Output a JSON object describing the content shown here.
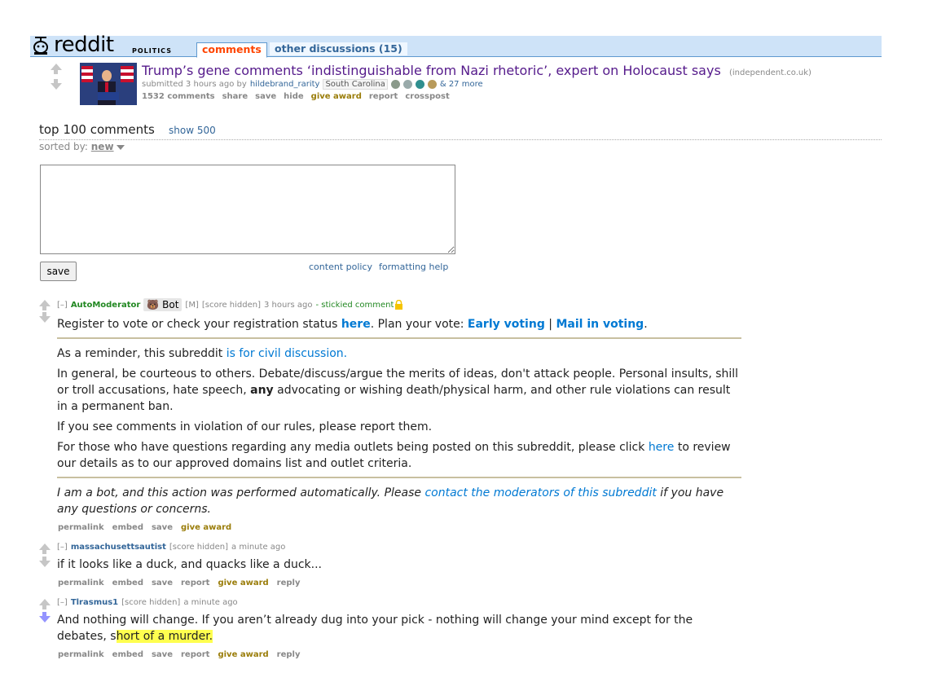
{
  "header": {
    "logo_text": "reddit",
    "subreddit": "politics",
    "tabs": [
      {
        "label": "comments"
      },
      {
        "label": "other discussions (15)"
      }
    ]
  },
  "post": {
    "title": "Trump’s gene comments ‘indistinguishable from Nazi rhetoric’, expert on Holocaust says",
    "domain": "(independent.co.uk)",
    "submitted": "submitted 3 hours ago by",
    "author": "hildebrand_rarity",
    "author_flair": "South Carolina",
    "awards_more": "& 27 more",
    "buttons": {
      "comments": "1532 comments",
      "share": "share",
      "save": "save",
      "hide": "hide",
      "award": "give award",
      "report": "report",
      "crosspost": "crosspost"
    }
  },
  "comments_area": {
    "heading": "top 100 comments",
    "show_more": "show 500",
    "sorted_label": "sorted by:",
    "sort_value": "new",
    "save_label": "save",
    "content_policy": "content policy",
    "formatting_help": "formatting help"
  },
  "comments": [
    {
      "collapse": "[–]",
      "author": "AutoModerator",
      "bot_label": "Bot",
      "mod_tag": "[M]",
      "score": "[score hidden]",
      "time": "3 hours ago",
      "stickied": "- stickied comment",
      "line1_a": "Register to vote or check your registration status ",
      "line1_link": "here",
      "line1_b": ". Plan your vote: ",
      "line1_early": "Early voting",
      "line1_sep": " | ",
      "line1_mail": "Mail in voting",
      "line1_end": ".",
      "p1_a": "As a reminder, this subreddit ",
      "p1_link": "is for civil discussion.",
      "p2_a": "In general, be courteous to others. Debate/discuss/argue the merits of ideas, don't attack people. Personal insults, shill or troll accusations, hate speech, ",
      "p2_bold": "any",
      "p2_b": " advocating or wishing death/physical harm, and other rule violations can result in a permanent ban.",
      "p3": "If you see comments in violation of our rules, please report them.",
      "p4_a": "For those who have questions regarding any media outlets being posted on this subreddit, please click ",
      "p4_link": "here",
      "p4_b": " to review our details as to our approved domains list and outlet criteria.",
      "p5_a": "I am a bot, and this action was performed automatically. Please ",
      "p5_link": "contact the moderators of this subreddit",
      "p5_b": " if you have any questions or concerns.",
      "buttons": [
        "permalink",
        "embed",
        "save",
        "give award"
      ]
    },
    {
      "collapse": "[–]",
      "author": "massachusettsautist",
      "score": "[score hidden]",
      "time": "a minute ago",
      "body": "if it looks like a duck, and quacks like a duck...",
      "buttons": [
        "permalink",
        "embed",
        "save",
        "report",
        "give award",
        "reply"
      ]
    },
    {
      "collapse": "[–]",
      "author": "Tlrasmus1",
      "score": "[score hidden]",
      "time": "a minute ago",
      "body_a": "And nothing will change. If you aren’t already dug into your pick - nothing will change your mind except for the debates, s",
      "body_highlight": "hort of a murder.",
      "buttons": [
        "permalink",
        "embed",
        "save",
        "report",
        "give award",
        "reply"
      ]
    }
  ]
}
